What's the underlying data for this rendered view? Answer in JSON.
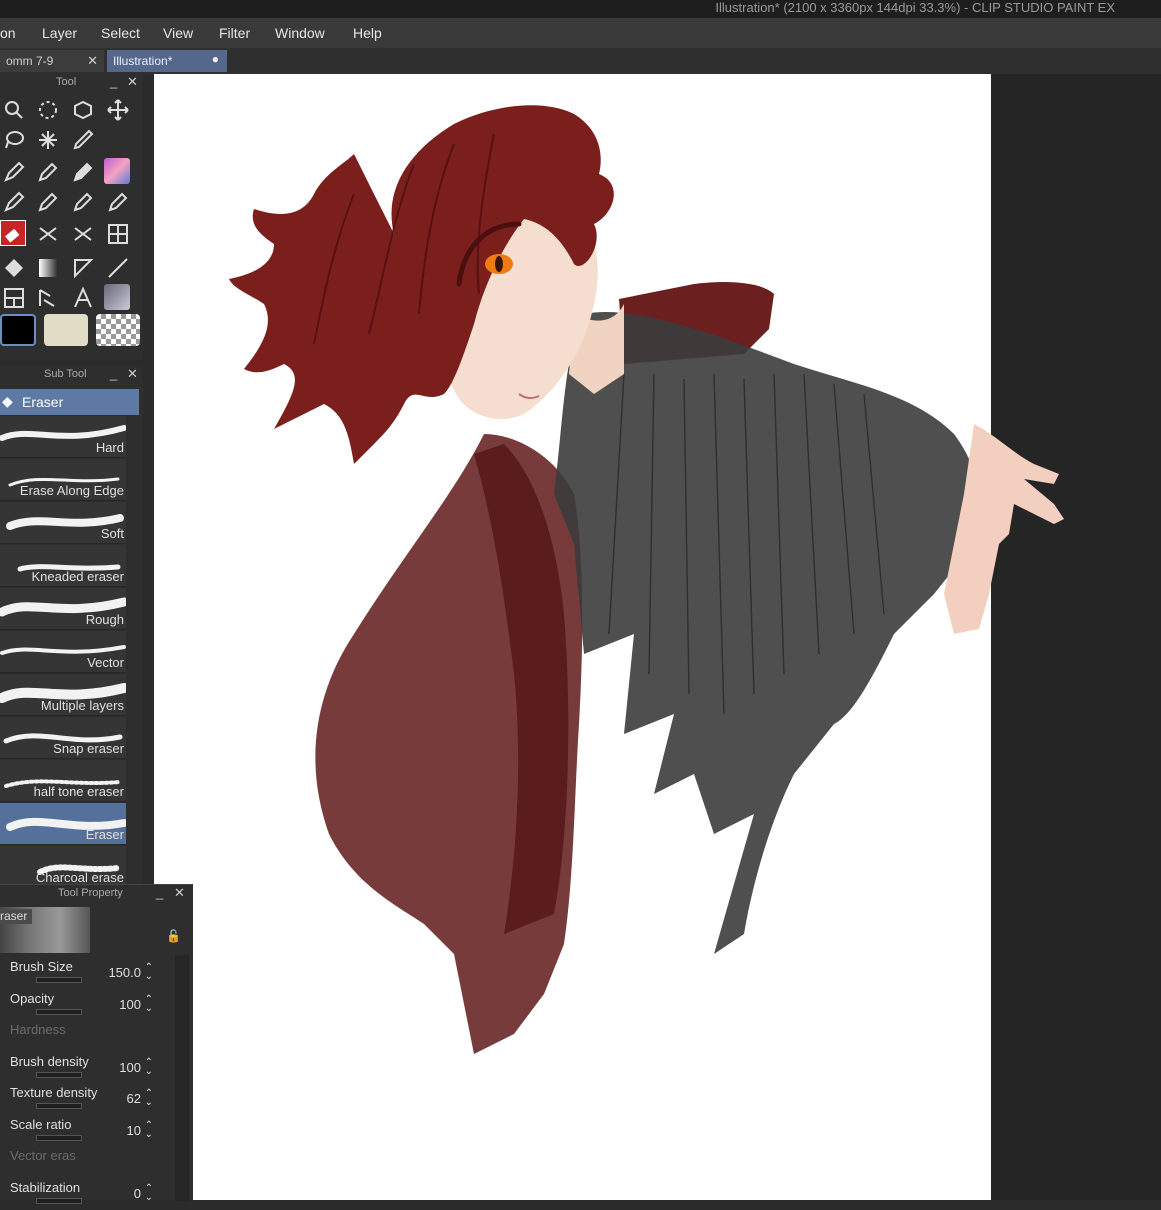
{
  "window": {
    "title": "Illustration* (2100 x 3360px 144dpi 33.3%)  - CLIP STUDIO PAINT EX"
  },
  "menu": [
    "on",
    "Layer",
    "Select",
    "View",
    "Filter",
    "Window",
    "Help"
  ],
  "tabs": [
    {
      "label": "omm 7-9",
      "close": "✕"
    },
    {
      "label": "Illustration*",
      "close": "●"
    }
  ],
  "tool_panel": {
    "title": "Tool",
    "minimize": "_",
    "close": "✕",
    "tools": [
      "zoom-icon",
      "lasso-icon",
      "object-icon",
      "move-icon",
      "lasso-select-icon",
      "magic-wand-icon",
      "eyedropper-icon",
      "pen-icon",
      "pencil-icon",
      "brush-icon",
      "decoration-icon",
      "eraser-icon",
      "ruler-icon",
      "figure-icon",
      "fill-icon",
      "gradient-icon",
      "frame-icon",
      "line-icon",
      "balloon-icon",
      "text-icon",
      "3d-icon"
    ],
    "colors": {
      "main": "#000000",
      "sub": "#e1dcc6",
      "transparent": "checker"
    }
  },
  "sub_tool_panel": {
    "title": "Sub Tool",
    "minimize": "_",
    "close": "✕",
    "active": "Eraser",
    "brushes": [
      "Hard",
      "Erase Along Edge",
      "Soft",
      "Kneaded eraser",
      "Rough",
      "Vector",
      "Multiple layers",
      "Snap eraser",
      "half tone eraser",
      "Eraser",
      "Charcoal erase"
    ],
    "selected_brush": "Eraser"
  },
  "tool_property": {
    "title": "Tool Property",
    "minimize": "_",
    "close": "✕",
    "preset_name": "raser",
    "rows": [
      {
        "name": "Brush Size",
        "value": "150.0",
        "dim": false
      },
      {
        "name": "Opacity",
        "value": "100",
        "dim": false
      },
      {
        "name": "Hardness",
        "value": "",
        "dim": true
      },
      {
        "name": "Brush density",
        "value": "100",
        "dim": false
      },
      {
        "name": "Texture density",
        "value": "62",
        "dim": false
      },
      {
        "name": "Scale ratio",
        "value": "10",
        "dim": false
      },
      {
        "name": "Vector eras",
        "value": "",
        "dim": true
      },
      {
        "name": "Stabilization",
        "value": "0",
        "dim": false
      }
    ]
  },
  "colors": {
    "accent": "#5c7aa3",
    "hair": "#7a1d1b",
    "eye": "#f07b14",
    "jacket": "#6b2322",
    "sweater": "#3b3b3b"
  }
}
